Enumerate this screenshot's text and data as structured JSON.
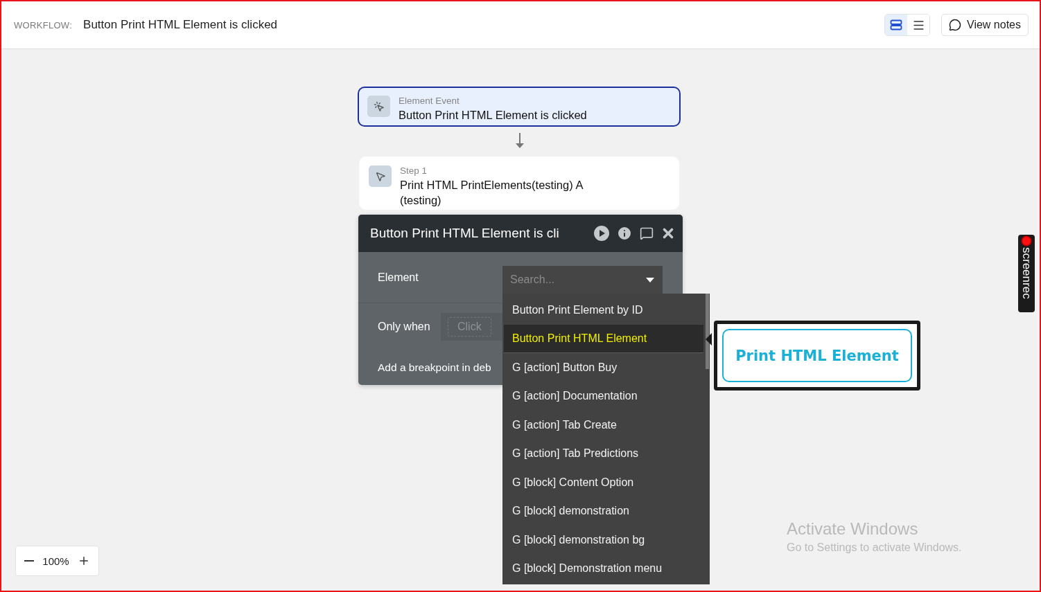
{
  "header": {
    "label": "WORKFLOW:",
    "title": "Button Print HTML Element is clicked",
    "view_toggle": [
      {
        "kind": "cards",
        "selected": true
      },
      {
        "kind": "list",
        "selected": false
      }
    ],
    "notes_button": "View notes"
  },
  "canvas": {
    "event": {
      "caption": "Element Event",
      "title": "Button Print HTML Element is clicked",
      "selected": true
    },
    "step": {
      "caption": "Step 1",
      "title": "Print HTML PrintElements(testing) A (testing)",
      "selected": false
    },
    "panel": {
      "title": "Button Print HTML Element is cli",
      "fields": [
        {
          "kind": "select",
          "label": "Element",
          "placeholder": "Search..."
        },
        {
          "kind": "condition",
          "label": "Only when",
          "placeholder": "Click"
        },
        {
          "kind": "text",
          "label": "Add a breakpoint in deb"
        }
      ]
    },
    "dropdown": {
      "options": [
        {
          "label": "Button Print Element by ID",
          "selected": false
        },
        {
          "label": "Button Print HTML Element",
          "selected": true
        },
        {
          "label": "G [action] Button Buy",
          "selected": false
        },
        {
          "label": "G [action] Documentation",
          "selected": false
        },
        {
          "label": "G [action] Tab Create",
          "selected": false
        },
        {
          "label": "G [action] Tab Predictions",
          "selected": false
        },
        {
          "label": "G [block] Content Option",
          "selected": false
        },
        {
          "label": "G [block] demonstration",
          "selected": false
        },
        {
          "label": "G [block] demonstration bg",
          "selected": false
        },
        {
          "label": "G [block] Demonstration menu",
          "selected": false
        }
      ]
    },
    "preview": {
      "button": "Print HTML Element"
    },
    "zoom": {
      "value": "100%"
    }
  },
  "overlays": {
    "recorder": "screenrec",
    "activation": {
      "title": "Activate Windows",
      "message": "Go to Settings to activate Windows."
    }
  }
}
